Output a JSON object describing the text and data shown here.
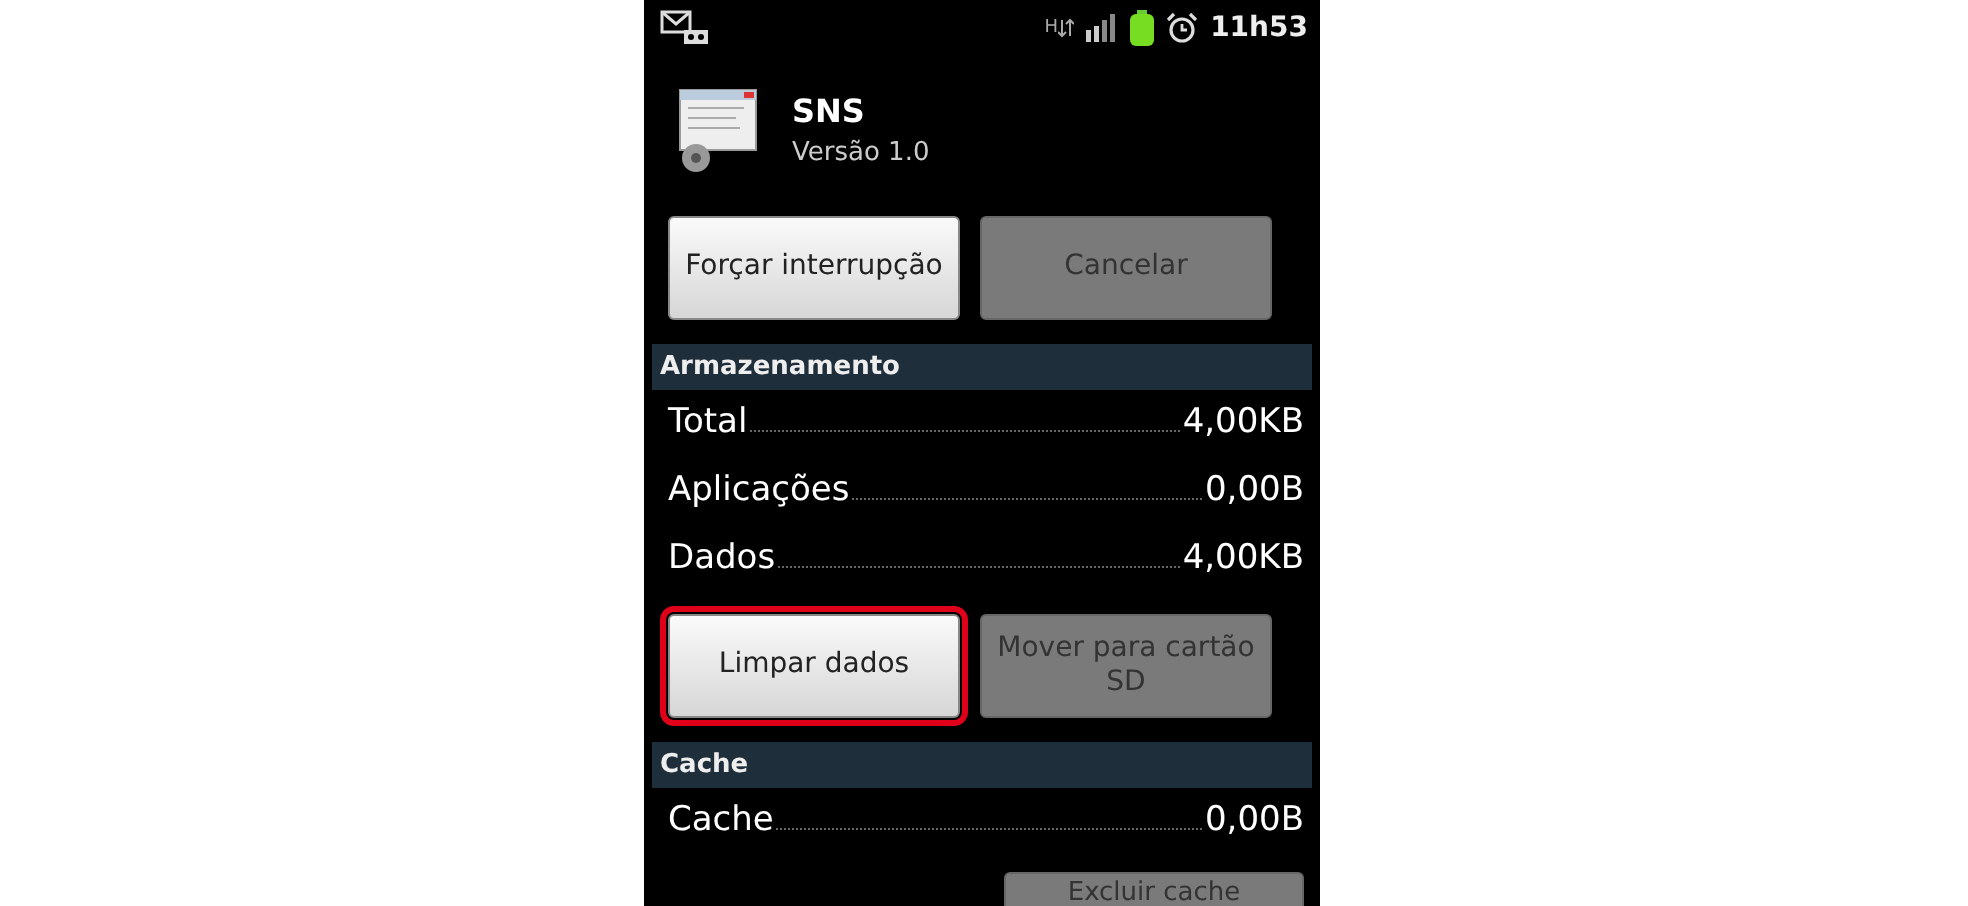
{
  "status_bar": {
    "time": "11h53",
    "network": "H"
  },
  "app": {
    "name": "SNS",
    "version": "Versão 1.0"
  },
  "app_buttons": [
    {
      "label": "Forçar interrupção",
      "disabled": false,
      "highlighted": false
    },
    {
      "label": "Cancelar",
      "disabled": true,
      "highlighted": false
    }
  ],
  "storage": {
    "title": "Armazenamento",
    "rows": [
      {
        "label": "Total",
        "value": "4,00KB"
      },
      {
        "label": "Aplicações",
        "value": "0,00B"
      },
      {
        "label": "Dados",
        "value": "4,00KB"
      }
    ],
    "buttons": [
      {
        "label": "Limpar dados",
        "disabled": false,
        "highlighted": true
      },
      {
        "label": "Mover para cartão SD",
        "disabled": true,
        "highlighted": false
      }
    ]
  },
  "cache": {
    "title": "Cache",
    "rows": [
      {
        "label": "Cache",
        "value": "0,00B"
      }
    ],
    "buttons": [
      {
        "label": "Excluir cache",
        "disabled": true,
        "highlighted": false
      }
    ]
  }
}
